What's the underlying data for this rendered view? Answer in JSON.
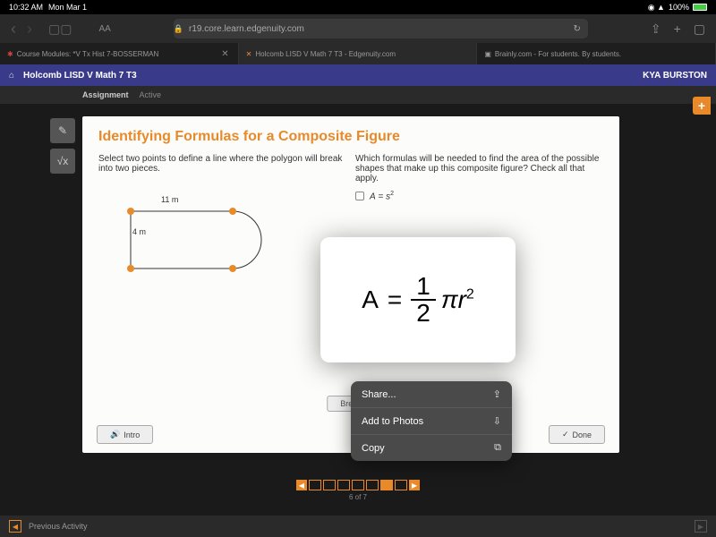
{
  "status": {
    "time": "10:32 AM",
    "date": "Mon Mar 1",
    "battery": "100%"
  },
  "safari": {
    "url": "r19.core.learn.edgenuity.com",
    "aa": "AA"
  },
  "tabs": [
    {
      "label": "Course Modules: *V Tx Hist 7-BOSSERMAN"
    },
    {
      "label": "Holcomb LISD V Math 7 T3 - Edgenuity.com"
    },
    {
      "label": "Brainly.com - For students. By students."
    }
  ],
  "header": {
    "course": "Holcomb LISD V Math 7 T3",
    "user": "KYA BURSTON"
  },
  "subheader": {
    "assignment": "Assignment",
    "active": "Active"
  },
  "panel": {
    "title": "Identifying Formulas for a Composite Figure",
    "left_instruction": "Select two points to define a line where the polygon will break into two pieces.",
    "right_instruction": "Which formulas will be needed to find the area of the possible shapes that make up this composite figure? Check all that apply.",
    "dim_top": "11 m",
    "dim_left": "4 m",
    "formula1": "A = s²",
    "break": "Break",
    "intro": "Intro",
    "done": "Done"
  },
  "popup_formula": {
    "lhs": "A",
    "eq": "=",
    "num": "1",
    "den": "2",
    "pi": "π",
    "r": "r",
    "sq": "2"
  },
  "menu": {
    "share": "Share...",
    "photos": "Add to Photos",
    "copy": "Copy"
  },
  "pagination": {
    "text": "6 of 7"
  },
  "footer": {
    "prev": "Previous Activity"
  }
}
